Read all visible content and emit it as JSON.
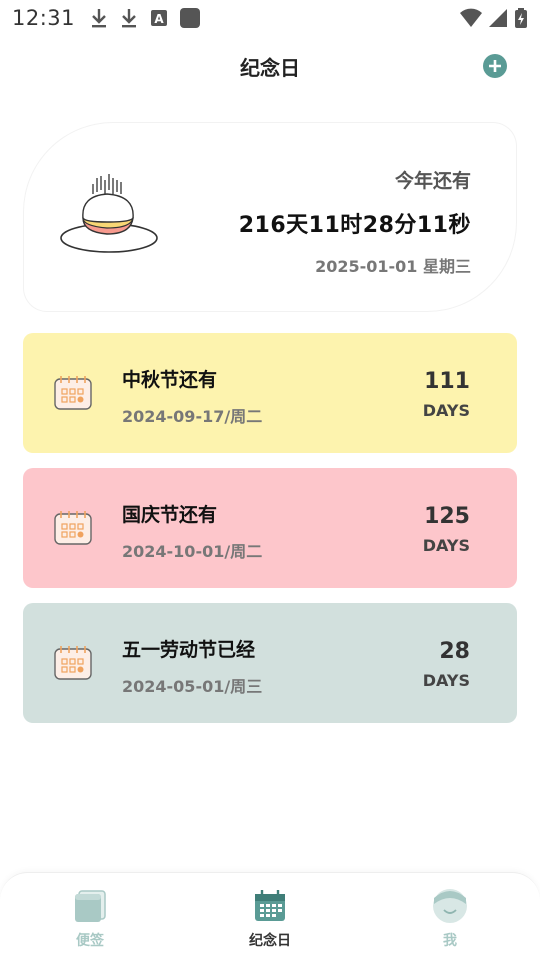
{
  "status_bar": {
    "time": "12:31"
  },
  "header": {
    "title": "纪念日",
    "add_icon": "plus-circle-icon"
  },
  "hero": {
    "label": "今年还有",
    "countdown": "216天11时28分11秒",
    "date": "2025-01-01 星期三",
    "image": "birthday-cake-icon"
  },
  "events": [
    {
      "title": "中秋节还有",
      "date": "2024-09-17/周二",
      "days": "111",
      "unit": "DAYS",
      "color": "#fdf3ae",
      "icon": "calendar-icon"
    },
    {
      "title": "国庆节还有",
      "date": "2024-10-01/周二",
      "days": "125",
      "unit": "DAYS",
      "color": "#fdc6cb",
      "icon": "calendar-icon"
    },
    {
      "title": "五一劳动节已经",
      "date": "2024-05-01/周三",
      "days": "28",
      "unit": "DAYS",
      "color": "#d2e0dd",
      "icon": "calendar-icon"
    }
  ],
  "bottom_nav": {
    "items": [
      {
        "label": "便签",
        "icon": "notes-icon",
        "active": false
      },
      {
        "label": "纪念日",
        "icon": "calendar-icon",
        "active": true
      },
      {
        "label": "我",
        "icon": "profile-face-icon",
        "active": false
      }
    ]
  },
  "colors": {
    "accent": "#5a9b95",
    "nav_inactive": "#a9c9c5"
  }
}
